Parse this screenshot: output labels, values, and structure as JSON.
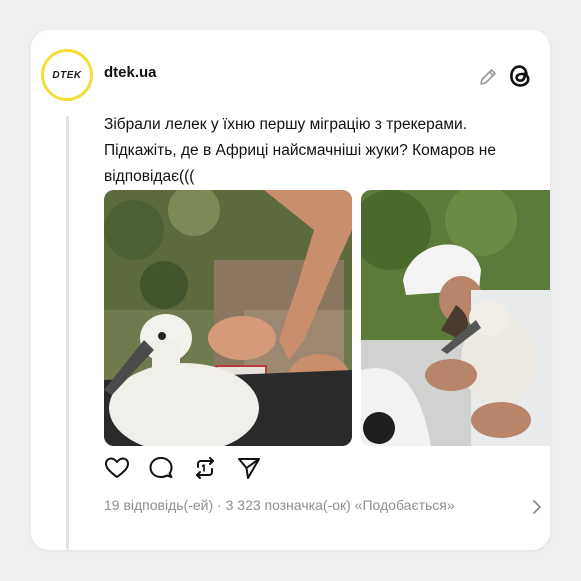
{
  "post": {
    "avatar_text": "DTEK",
    "username": "dtek.ua",
    "text": "Зібрали лелек у їхню першу міграцію з трекерами.\nПідкажіть, де в Африці найсмачніші жуки? Комаров не\nвідповідає(((",
    "stats": {
      "replies": "19 відповідь(-ей)",
      "separator": "·",
      "likes": "3 323 позначка(-ок) «Подобається»"
    }
  },
  "icons": {
    "edit": "pencil-icon",
    "brand": "threads-logo-icon",
    "like": "heart-icon",
    "reply": "comment-icon",
    "repost": "repost-icon",
    "share": "send-icon",
    "more": "chevron-right-icon"
  },
  "colors": {
    "background": "#efeff1",
    "card": "#ffffff",
    "avatar_ring": "#f5dc3b",
    "muted_text": "#8e8e93"
  }
}
